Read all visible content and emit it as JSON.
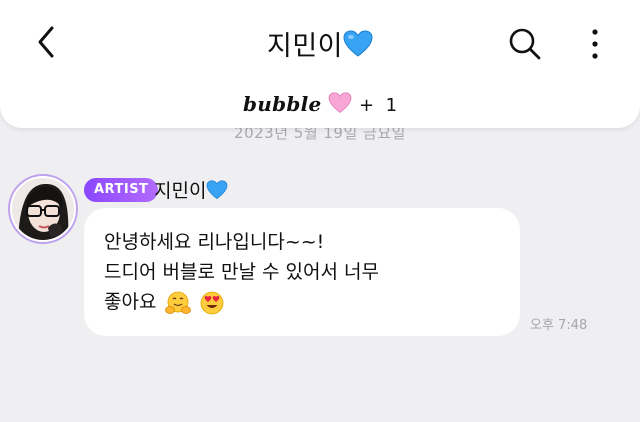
{
  "header": {
    "title": "지민이",
    "title_icon": "blue-heart-icon",
    "bubble_brand": "bubble",
    "bubble_icon": "pink-heart-icon",
    "bubble_count": "+  1",
    "accent_blue": "#3aa0f0",
    "accent_pink": "#f79ad0"
  },
  "chat": {
    "date_separator": "2023년 5월 19일 금요일",
    "sender": {
      "badge": "ARTIST",
      "name": "지민이",
      "name_icon": "blue-heart-icon",
      "badge_color": "#8a47ff"
    },
    "message": {
      "line1": "안녕하세요 리나입니다~~!",
      "line2": "드디어 버블로 만날 수 있어서 너무",
      "line3": "좋아요",
      "emojis": [
        "hugging-face-emoji",
        "heart-eyes-emoji"
      ],
      "time": "오후 7:48"
    }
  }
}
